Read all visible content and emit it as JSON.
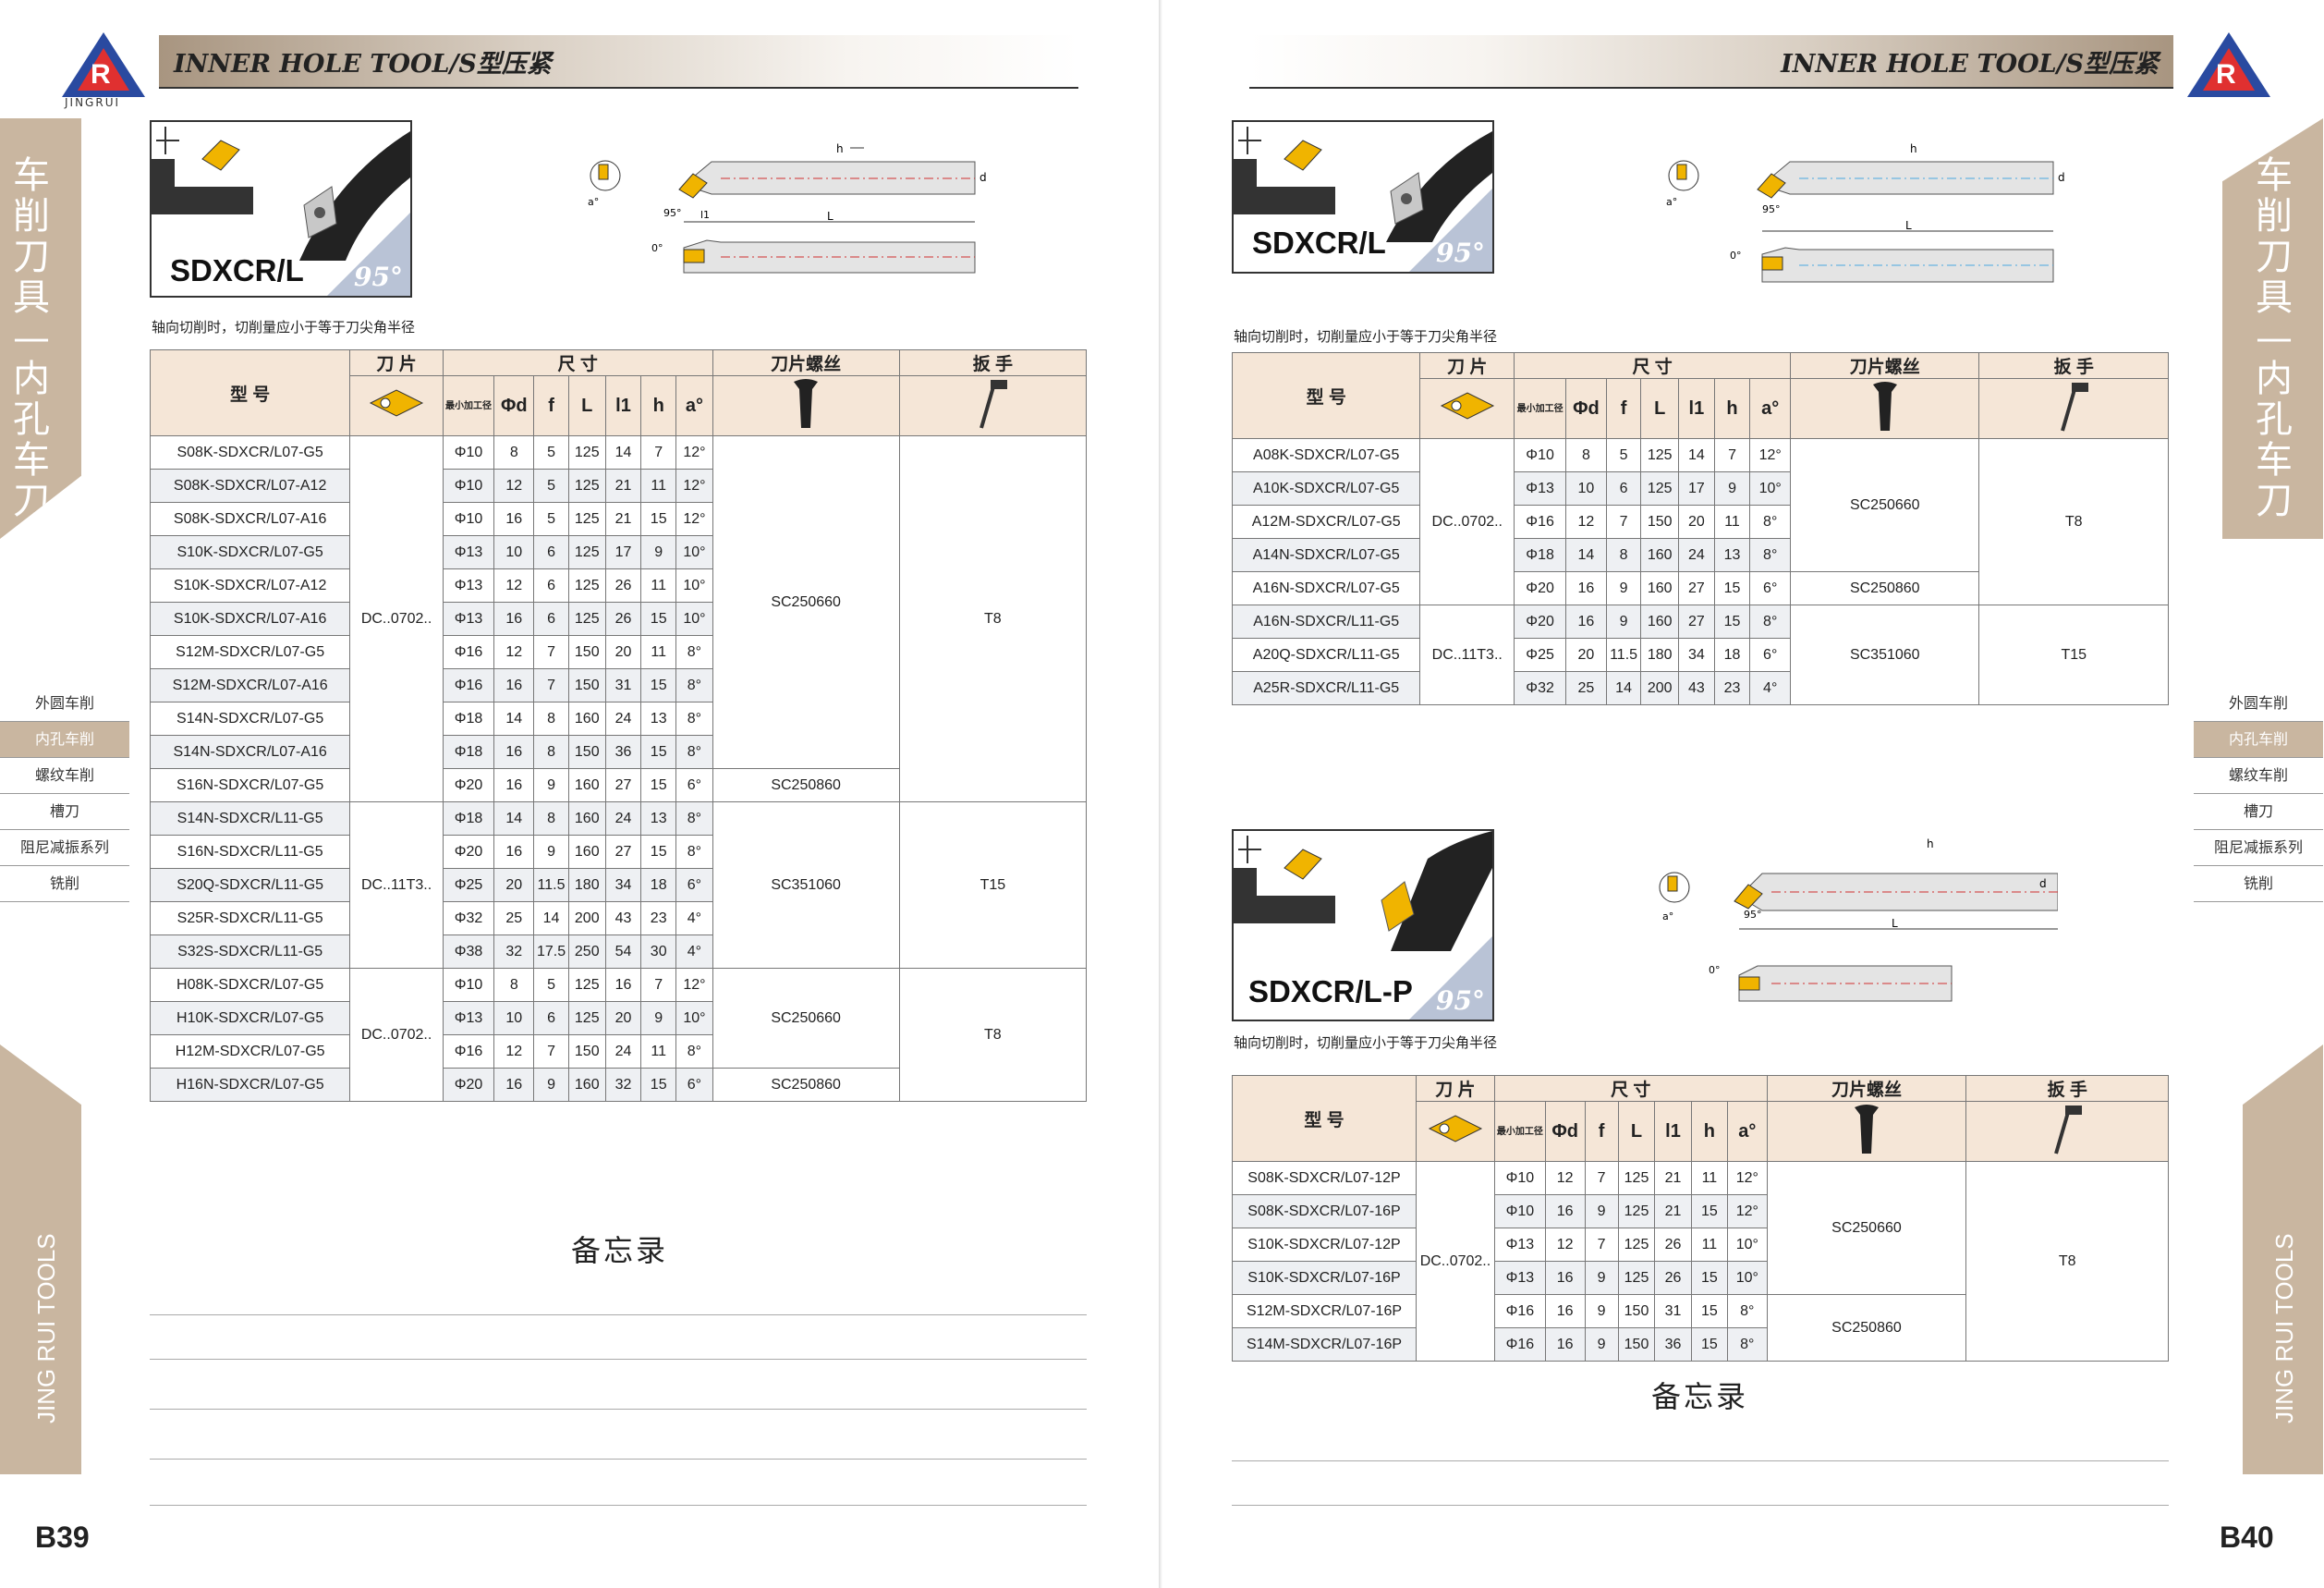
{
  "header": {
    "left_title": "INNER HOLE TOOL/S型压紧",
    "right_title": "INNER HOLE TOOL/S型压紧",
    "brand": "JINGRUI"
  },
  "side": {
    "title": "车削刀具—内孔车刀",
    "english": "JING RUI TOOLS"
  },
  "menu": [
    "外圆车削",
    "内孔车削",
    "螺纹车削",
    "槽刀",
    "阻尼减振系列",
    "铣削"
  ],
  "menu_active": 1,
  "pages": {
    "left": "B39",
    "right": "B40"
  },
  "headers": {
    "model": "型 号",
    "insert": "刀 片",
    "size": "尺 寸",
    "screw": "刀片螺丝",
    "wrench": "扳 手",
    "min_bore": "最小加工径",
    "cols": [
      "Φd",
      "f",
      "L",
      "l1",
      "h",
      "a°"
    ]
  },
  "note": "轴向切削时，切削量应小于等于刀尖角半径",
  "memo": "备忘录",
  "table1": {
    "product": "SDXCR/L",
    "angle": "95°",
    "rows": [
      [
        "S08K-SDXCR/L07-G5",
        "Φ10",
        "8",
        "5",
        "125",
        "14",
        "7",
        "12°"
      ],
      [
        "S08K-SDXCR/L07-A12",
        "Φ10",
        "12",
        "5",
        "125",
        "21",
        "11",
        "12°"
      ],
      [
        "S08K-SDXCR/L07-A16",
        "Φ10",
        "16",
        "5",
        "125",
        "21",
        "15",
        "12°"
      ],
      [
        "S10K-SDXCR/L07-G5",
        "Φ13",
        "10",
        "6",
        "125",
        "17",
        "9",
        "10°"
      ],
      [
        "S10K-SDXCR/L07-A12",
        "Φ13",
        "12",
        "6",
        "125",
        "26",
        "11",
        "10°"
      ],
      [
        "S10K-SDXCR/L07-A16",
        "Φ13",
        "16",
        "6",
        "125",
        "26",
        "15",
        "10°"
      ],
      [
        "S12M-SDXCR/L07-G5",
        "Φ16",
        "12",
        "7",
        "150",
        "20",
        "11",
        "8°"
      ],
      [
        "S12M-SDXCR/L07-A16",
        "Φ16",
        "16",
        "7",
        "150",
        "31",
        "15",
        "8°"
      ],
      [
        "S14N-SDXCR/L07-G5",
        "Φ18",
        "14",
        "8",
        "160",
        "24",
        "13",
        "8°"
      ],
      [
        "S14N-SDXCR/L07-A16",
        "Φ18",
        "16",
        "8",
        "150",
        "36",
        "15",
        "8°"
      ],
      [
        "S16N-SDXCR/L07-G5",
        "Φ20",
        "16",
        "9",
        "160",
        "27",
        "15",
        "6°"
      ],
      [
        "S14N-SDXCR/L11-G5",
        "Φ18",
        "14",
        "8",
        "160",
        "24",
        "13",
        "8°"
      ],
      [
        "S16N-SDXCR/L11-G5",
        "Φ20",
        "16",
        "9",
        "160",
        "27",
        "15",
        "8°"
      ],
      [
        "S20Q-SDXCR/L11-G5",
        "Φ25",
        "20",
        "11.5",
        "180",
        "34",
        "18",
        "6°"
      ],
      [
        "S25R-SDXCR/L11-G5",
        "Φ32",
        "25",
        "14",
        "200",
        "43",
        "23",
        "4°"
      ],
      [
        "S32S-SDXCR/L11-G5",
        "Φ38",
        "32",
        "17.5",
        "250",
        "54",
        "30",
        "4°"
      ],
      [
        "H08K-SDXCR/L07-G5",
        "Φ10",
        "8",
        "5",
        "125",
        "16",
        "7",
        "12°"
      ],
      [
        "H10K-SDXCR/L07-G5",
        "Φ13",
        "10",
        "6",
        "125",
        "20",
        "9",
        "10°"
      ],
      [
        "H12M-SDXCR/L07-G5",
        "Φ16",
        "12",
        "7",
        "150",
        "24",
        "11",
        "8°"
      ],
      [
        "H16N-SDXCR/L07-G5",
        "Φ20",
        "16",
        "9",
        "160",
        "32",
        "15",
        "6°"
      ]
    ],
    "inserts": [
      "DC..0702..",
      "DC..11T3..",
      "DC..0702.."
    ],
    "screws": [
      "SC250660",
      "SC250860",
      "SC351060",
      "SC250660",
      "SC250860"
    ],
    "wrenches": [
      "T8",
      "T15",
      "T8"
    ]
  },
  "table2": {
    "product": "SDXCR/L",
    "angle": "95°",
    "rows": [
      [
        "A08K-SDXCR/L07-G5",
        "Φ10",
        "8",
        "5",
        "125",
        "14",
        "7",
        "12°"
      ],
      [
        "A10K-SDXCR/L07-G5",
        "Φ13",
        "10",
        "6",
        "125",
        "17",
        "9",
        "10°"
      ],
      [
        "A12M-SDXCR/L07-G5",
        "Φ16",
        "12",
        "7",
        "150",
        "20",
        "11",
        "8°"
      ],
      [
        "A14N-SDXCR/L07-G5",
        "Φ18",
        "14",
        "8",
        "160",
        "24",
        "13",
        "8°"
      ],
      [
        "A16N-SDXCR/L07-G5",
        "Φ20",
        "16",
        "9",
        "160",
        "27",
        "15",
        "6°"
      ],
      [
        "A16N-SDXCR/L11-G5",
        "Φ20",
        "16",
        "9",
        "160",
        "27",
        "15",
        "8°"
      ],
      [
        "A20Q-SDXCR/L11-G5",
        "Φ25",
        "20",
        "11.5",
        "180",
        "34",
        "18",
        "6°"
      ],
      [
        "A25R-SDXCR/L11-G5",
        "Φ32",
        "25",
        "14",
        "200",
        "43",
        "23",
        "4°"
      ]
    ],
    "inserts": [
      "DC..0702..",
      "DC..11T3.."
    ],
    "screws": [
      "SC250660",
      "SC250860",
      "SC351060"
    ],
    "wrenches": [
      "T8",
      "T15"
    ]
  },
  "table3": {
    "product": "SDXCR/L-P",
    "angle": "95°",
    "rows": [
      [
        "S08K-SDXCR/L07-12P",
        "Φ10",
        "12",
        "7",
        "125",
        "21",
        "11",
        "12°"
      ],
      [
        "S08K-SDXCR/L07-16P",
        "Φ10",
        "16",
        "9",
        "125",
        "21",
        "15",
        "12°"
      ],
      [
        "S10K-SDXCR/L07-12P",
        "Φ13",
        "12",
        "7",
        "125",
        "26",
        "11",
        "10°"
      ],
      [
        "S10K-SDXCR/L07-16P",
        "Φ13",
        "16",
        "9",
        "125",
        "26",
        "15",
        "10°"
      ],
      [
        "S12M-SDXCR/L07-16P",
        "Φ16",
        "16",
        "9",
        "150",
        "31",
        "15",
        "8°"
      ],
      [
        "S14M-SDXCR/L07-16P",
        "Φ16",
        "16",
        "9",
        "150",
        "36",
        "15",
        "8°"
      ]
    ],
    "inserts": [
      "DC..0702.."
    ],
    "screws": [
      "SC250660",
      "SC250860"
    ],
    "wrenches": [
      "T8"
    ]
  },
  "dims": {
    "h": "h",
    "d": "d",
    "L": "L",
    "l1": "l1",
    "a": "a°",
    "ang95": "95°",
    "zero": "0°"
  },
  "colors": {
    "accent": "#c9b6a0",
    "header_bg": "#f5e6d7",
    "insert": "#f0b400",
    "centerline": "#d03030"
  }
}
